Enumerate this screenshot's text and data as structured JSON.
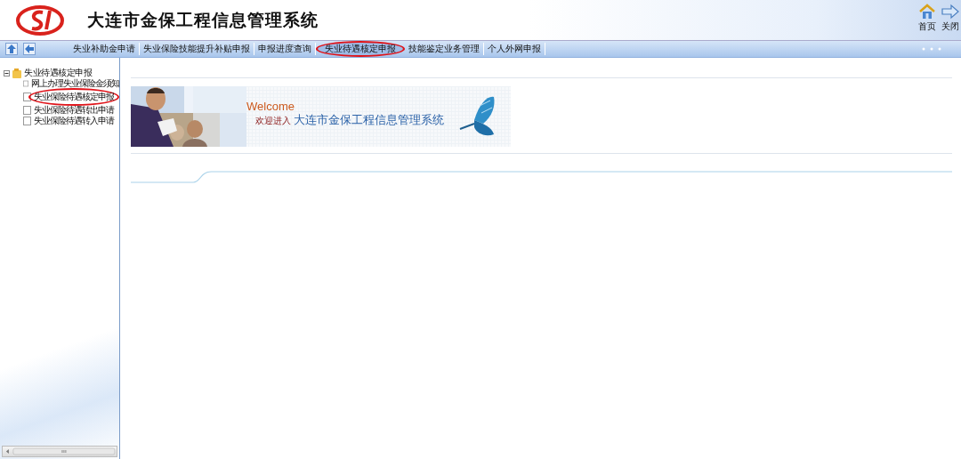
{
  "header": {
    "title": "大连市金保工程信息管理系统",
    "actions": [
      {
        "kind": "home",
        "label": "首页"
      },
      {
        "kind": "close",
        "label": "关闭"
      }
    ]
  },
  "menu": [
    {
      "label": "失业补助金申请",
      "circled": false
    },
    {
      "label": "失业保险技能提升补贴申报",
      "circled": false
    },
    {
      "label": "申报进度查询",
      "circled": false
    },
    {
      "label": "失业待遇核定申报",
      "circled": true
    },
    {
      "label": "技能鉴定业务管理",
      "circled": false
    },
    {
      "label": "个人外网申报",
      "circled": false
    }
  ],
  "tree": {
    "label": "失业待遇核定申报",
    "expanded": true,
    "children": [
      {
        "label": "网上办理失业保险金须知",
        "circled": false
      },
      {
        "label": "失业保险待遇核定申报",
        "circled": true
      },
      {
        "label": "失业保险待遇转出申请",
        "circled": false
      },
      {
        "label": "失业保险待遇转入申请",
        "circled": false
      }
    ]
  },
  "banner": {
    "heading": "Welcome",
    "prefix": "欢迎进入",
    "name": "大连市金保工程信息管理系统"
  }
}
